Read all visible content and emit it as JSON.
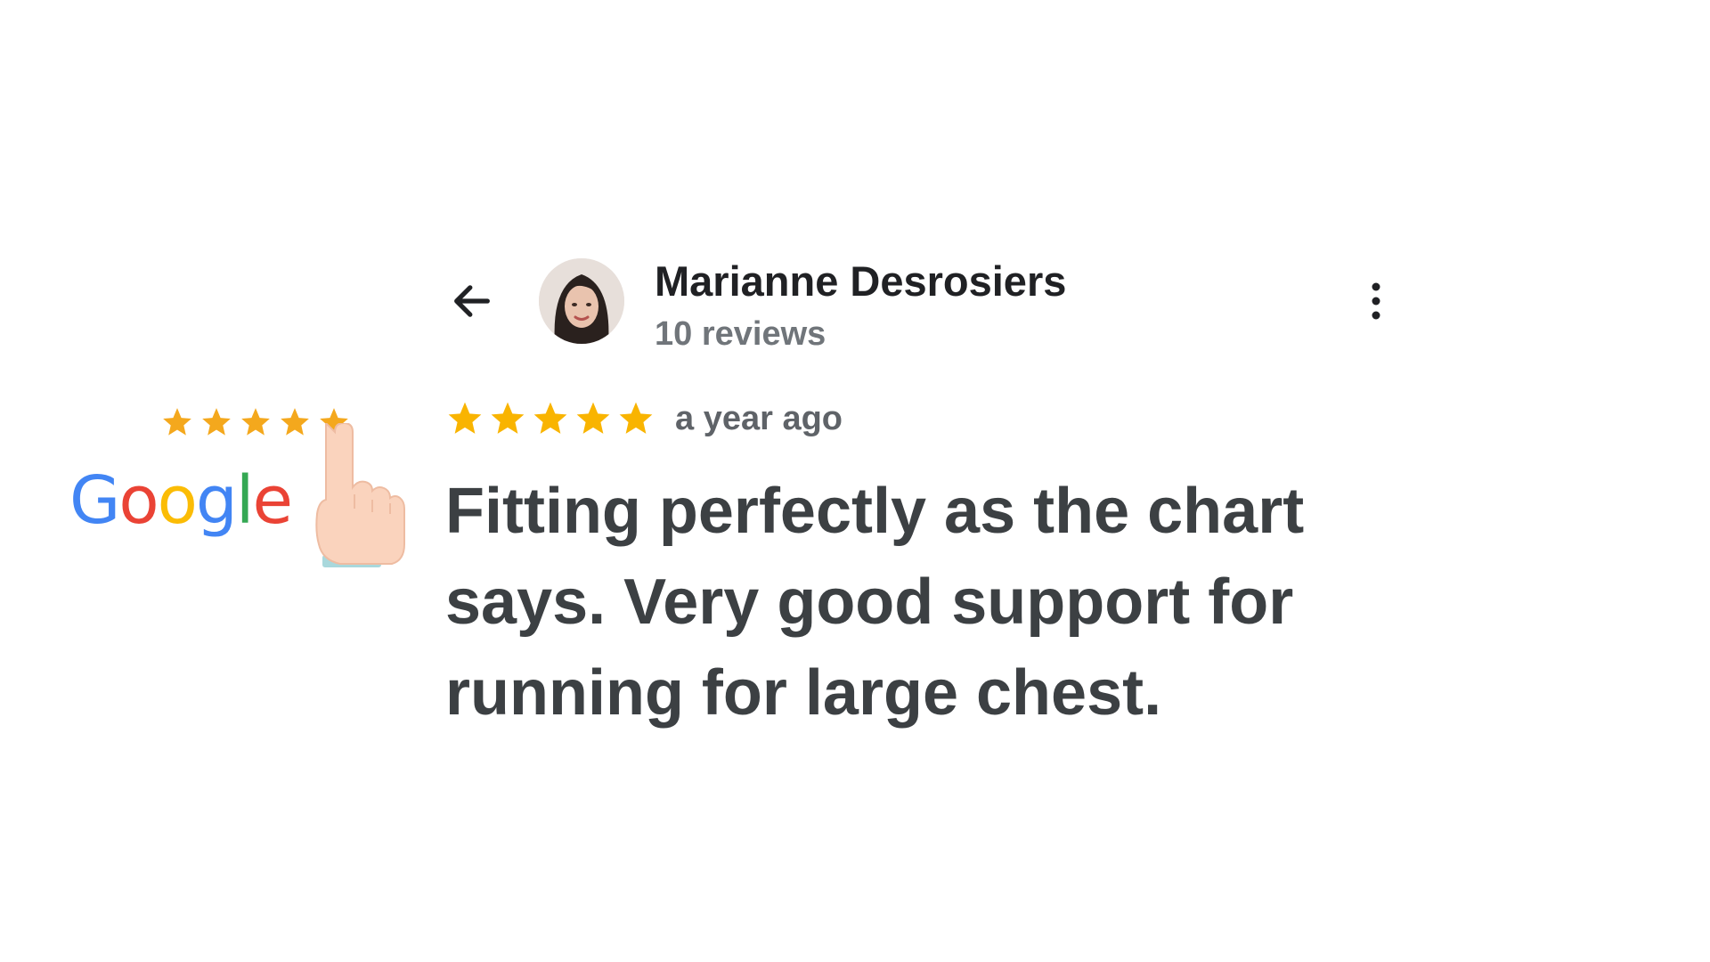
{
  "promo": {
    "logo_text": "Google",
    "logo_letters": [
      "G",
      "o",
      "o",
      "g",
      "l",
      "e"
    ],
    "star_rating": 5,
    "icons": [
      "star-icon",
      "pointing-hand-icon"
    ],
    "colors": {
      "blue": "#4285F4",
      "red": "#EA4335",
      "yellow": "#FBBC05",
      "green": "#34A853",
      "star": "#F4A81D"
    }
  },
  "review": {
    "reviewer_name": "Marianne Desrosiers",
    "review_count": "10 reviews",
    "rating": 5,
    "time": "a year ago",
    "text": "Fitting perfectly as the chart says. Very good support for running for large chest.",
    "icons": [
      "back-arrow-icon",
      "avatar",
      "more-vert-icon",
      "star-icon"
    ],
    "colors": {
      "star": "#F9B400",
      "name": "#202124",
      "meta": "#70757a",
      "body": "#3c4043"
    }
  }
}
